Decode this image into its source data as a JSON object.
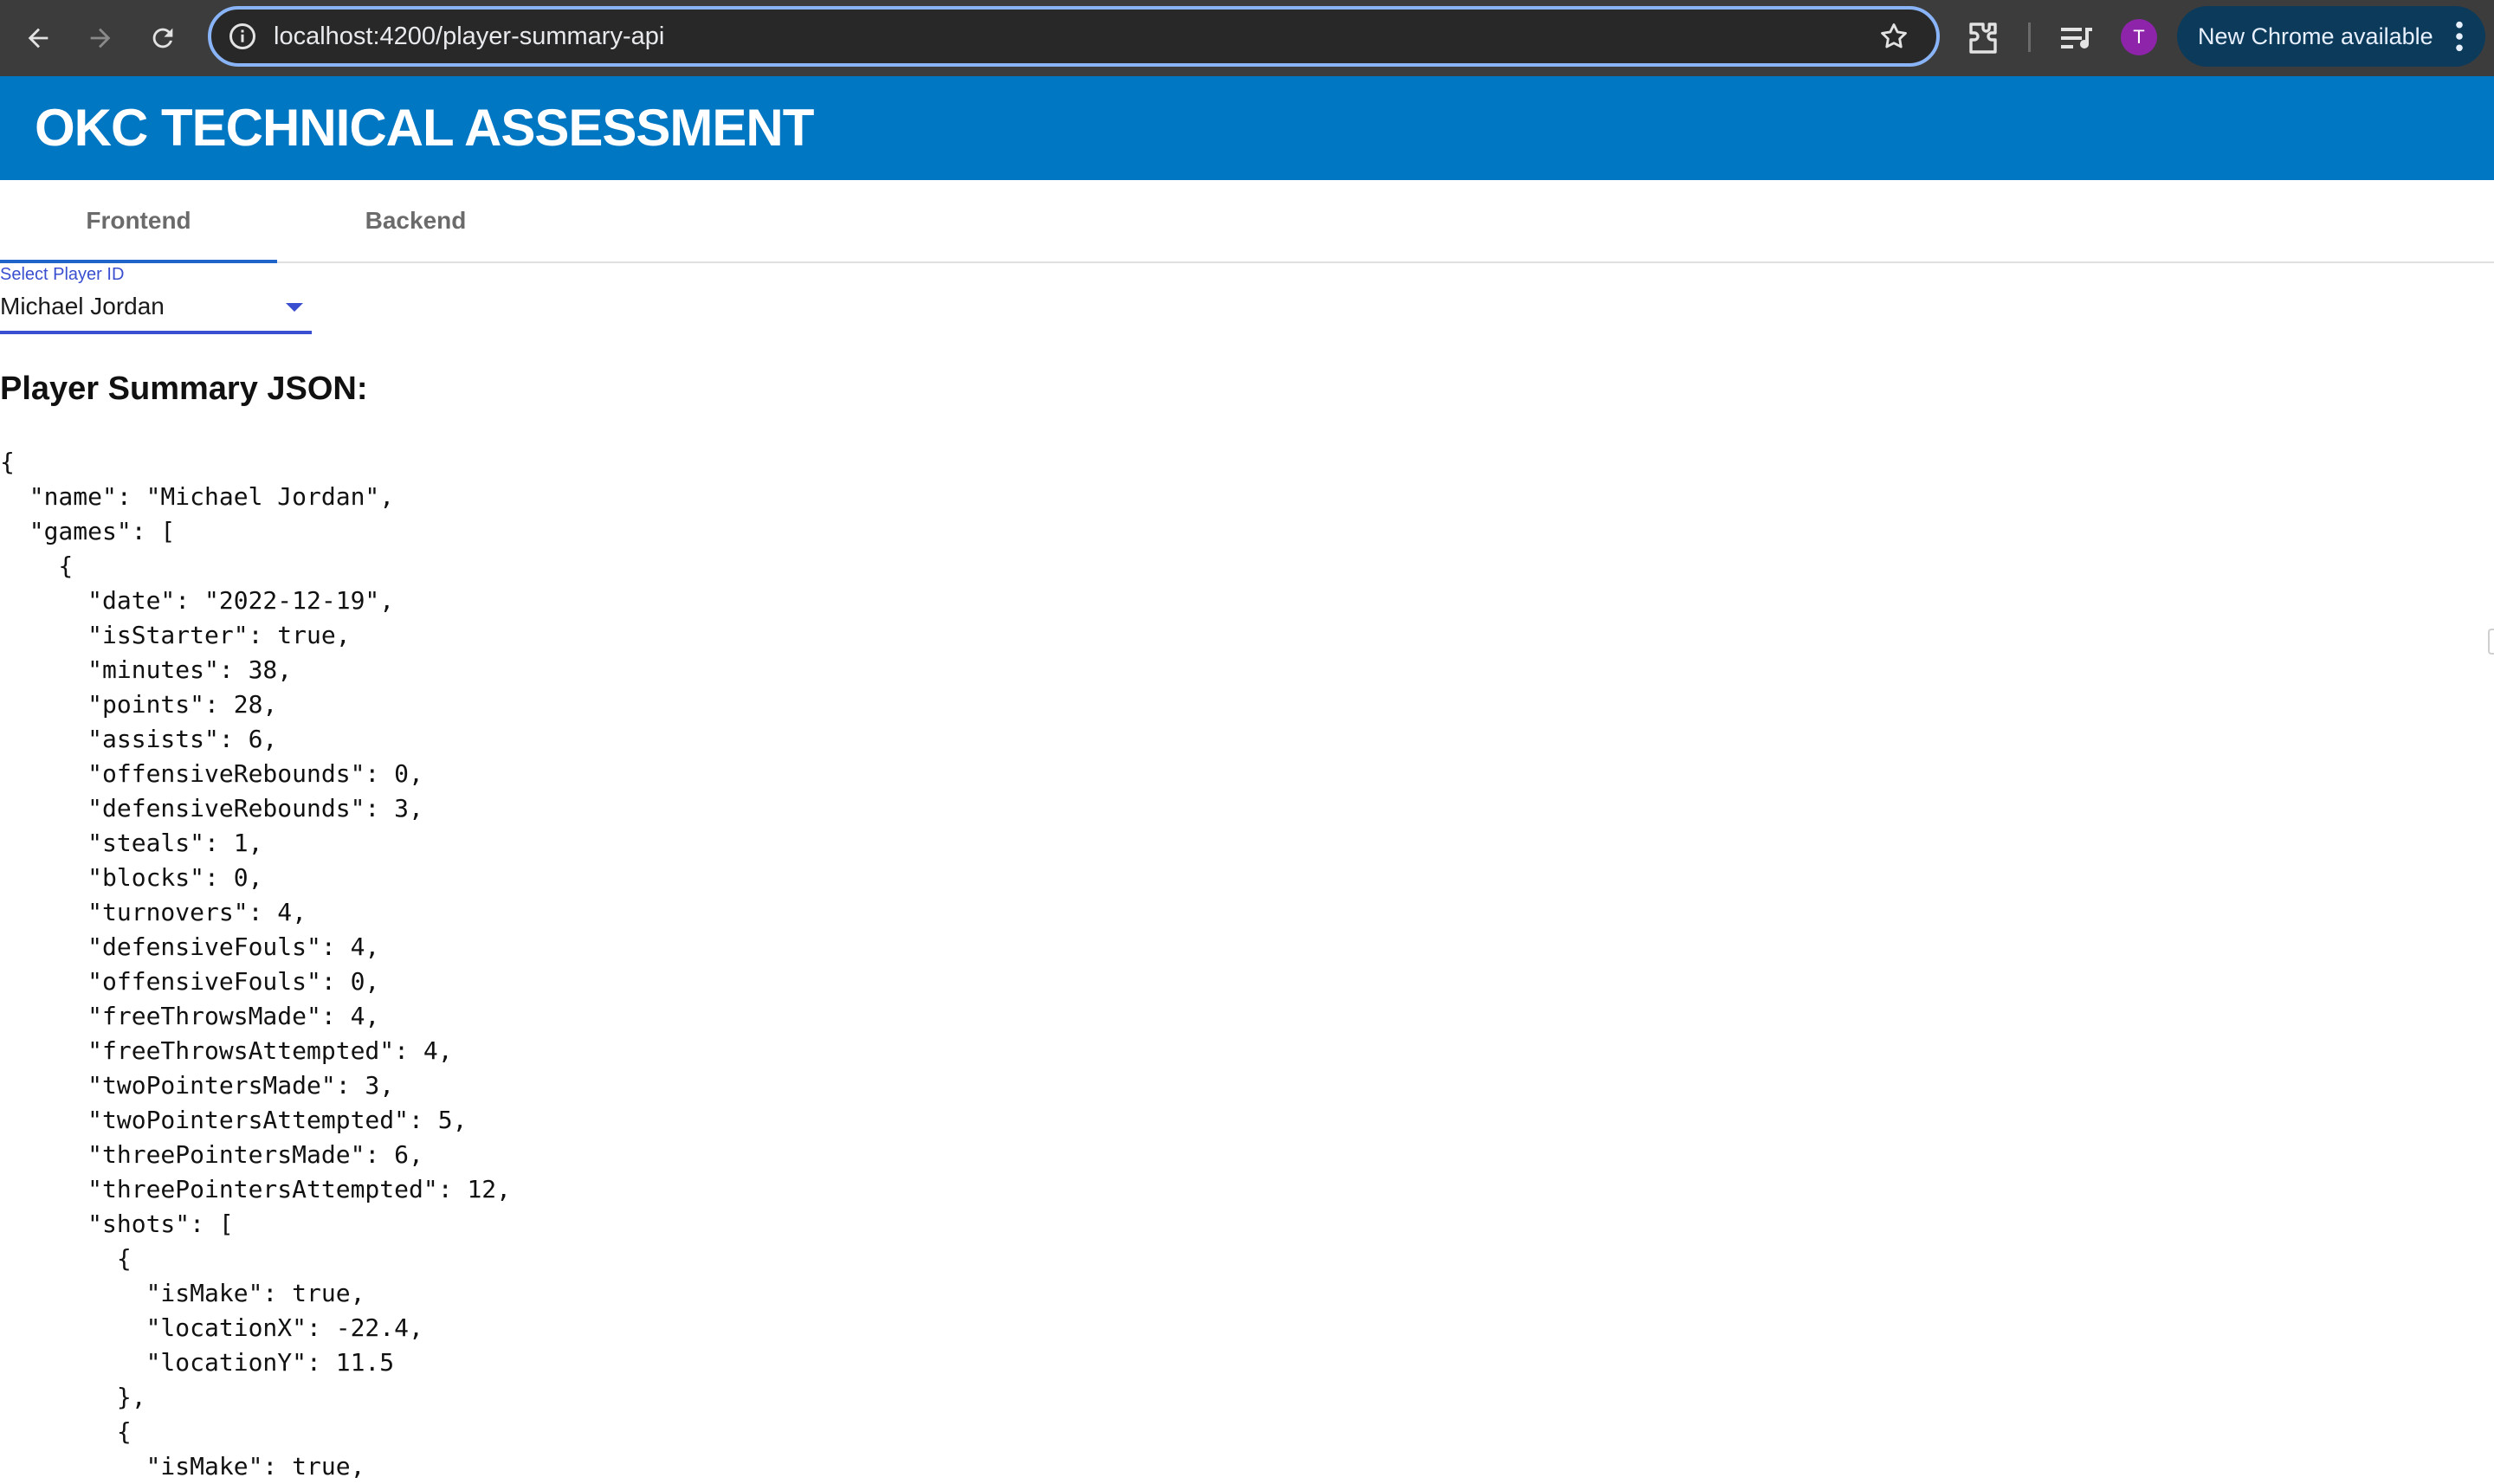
{
  "browser": {
    "url": "localhost:4200/player-summary-api",
    "profile_initial": "T",
    "update_label": "New Chrome available"
  },
  "app": {
    "title": "OKC TECHNICAL ASSESSMENT"
  },
  "tabs": [
    {
      "label": "Frontend",
      "active": true
    },
    {
      "label": "Backend",
      "active": false
    }
  ],
  "player_select": {
    "label": "Select Player ID",
    "value": "Michael Jordan"
  },
  "summary": {
    "heading": "Player Summary JSON:",
    "json_lines": [
      "{",
      "  \"name\": \"Michael Jordan\",",
      "  \"games\": [",
      "    {",
      "      \"date\": \"2022-12-19\",",
      "      \"isStarter\": true,",
      "      \"minutes\": 38,",
      "      \"points\": 28,",
      "      \"assists\": 6,",
      "      \"offensiveRebounds\": 0,",
      "      \"defensiveRebounds\": 3,",
      "      \"steals\": 1,",
      "      \"blocks\": 0,",
      "      \"turnovers\": 4,",
      "      \"defensiveFouls\": 4,",
      "      \"offensiveFouls\": 0,",
      "      \"freeThrowsMade\": 4,",
      "      \"freeThrowsAttempted\": 4,",
      "      \"twoPointersMade\": 3,",
      "      \"twoPointersAttempted\": 5,",
      "      \"threePointersMade\": 6,",
      "      \"threePointersAttempted\": 12,",
      "      \"shots\": [",
      "        {",
      "          \"isMake\": true,",
      "          \"locationX\": -22.4,",
      "          \"locationY\": 11.5",
      "        },",
      "        {",
      "          \"isMake\": true,"
    ]
  },
  "colors": {
    "header_blue": "#0077c2",
    "tab_indicator": "#1f65c9",
    "select_accent": "#3a4fd0",
    "browser_toolbar": "#3c3c3c"
  },
  "icons": [
    "back-arrow-icon",
    "forward-arrow-icon",
    "reload-icon",
    "site-info-icon",
    "bookmark-star-icon",
    "extensions-icon",
    "reading-list-icon",
    "more-vert-icon",
    "chevron-down-icon"
  ]
}
